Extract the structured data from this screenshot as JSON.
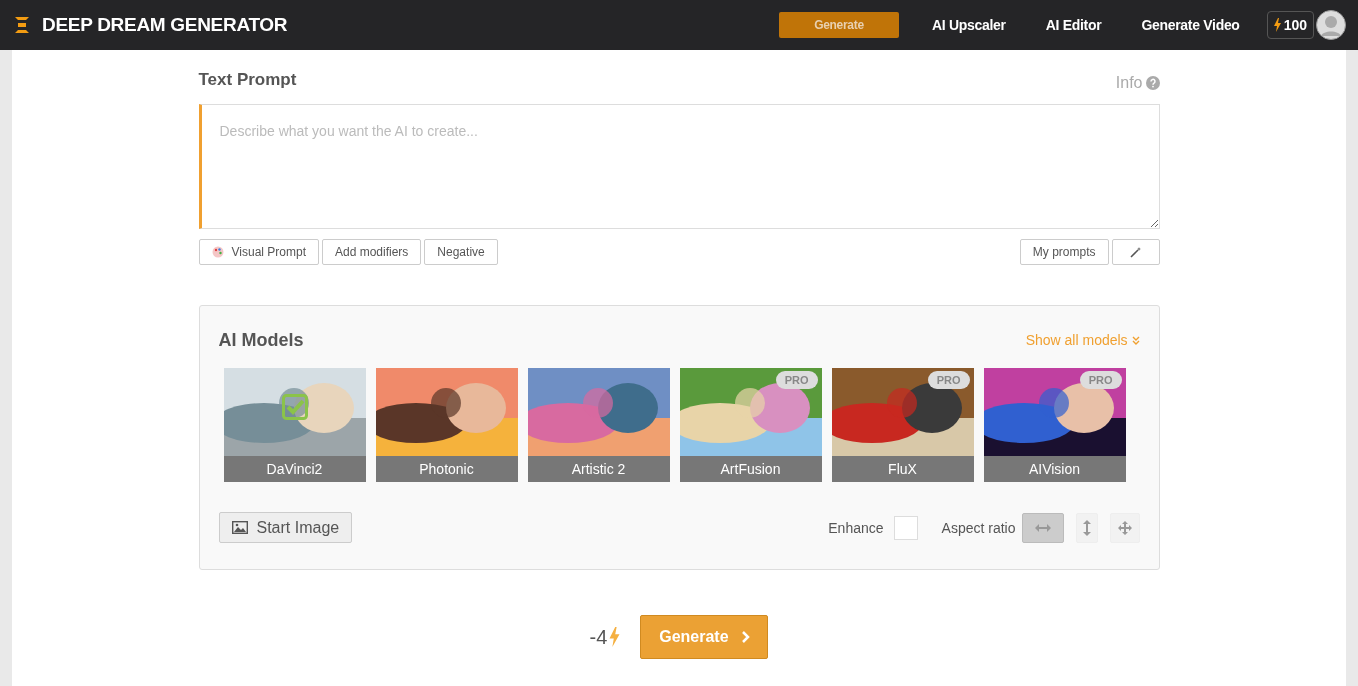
{
  "header": {
    "brand": "DEEP DREAM GENERATOR",
    "nav": [
      {
        "label": "Generate",
        "selected": true
      },
      {
        "label": "AI Upscaler",
        "selected": false
      },
      {
        "label": "AI Editor",
        "selected": false
      },
      {
        "label": "Generate Video",
        "selected": false
      }
    ],
    "credits": "100"
  },
  "prompt": {
    "title": "Text Prompt",
    "info": "Info",
    "placeholder": "Describe what you want the AI to create...",
    "left_buttons": [
      "Visual Prompt",
      "Add modifiers",
      "Negative"
    ],
    "right_buttons": [
      "My prompts"
    ]
  },
  "models": {
    "title": "AI Models",
    "show_all": "Show all models",
    "items": [
      {
        "name": "DaVinci2",
        "selected": true
      },
      {
        "name": "Photonic",
        "selected": false
      },
      {
        "name": "Artistic 2",
        "selected": false
      },
      {
        "name": "ArtFusion",
        "selected": false,
        "badge": "PRO"
      },
      {
        "name": "FluX",
        "selected": false,
        "badge": "PRO"
      },
      {
        "name": "AIVision",
        "selected": false,
        "badge": "PRO"
      }
    ],
    "start_image": "Start Image",
    "enhance": {
      "label": "Enhance",
      "checked": false
    },
    "aspect": {
      "label": "Aspect ratio",
      "options": [
        {
          "kind": "horizontal",
          "selected": true
        },
        {
          "kind": "vertical",
          "selected": false
        },
        {
          "kind": "free",
          "selected": false
        }
      ]
    }
  },
  "footer": {
    "cost": "-4",
    "generate": "Generate"
  }
}
